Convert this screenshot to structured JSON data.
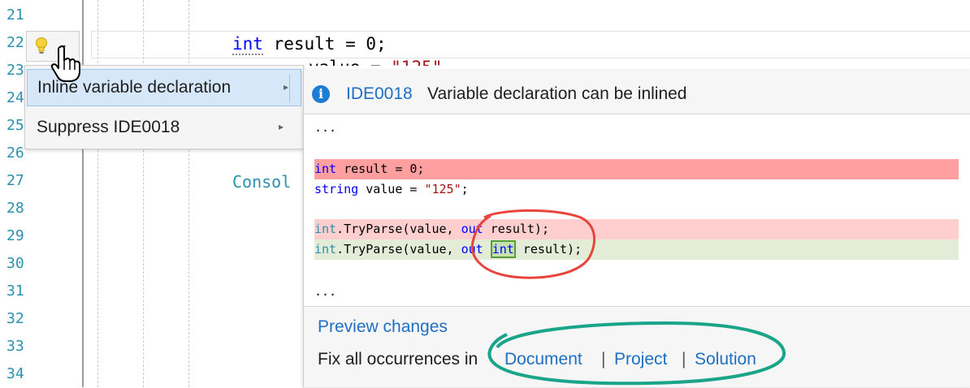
{
  "editor": {
    "line_numbers": [
      "21",
      "22",
      "23",
      "24",
      "25",
      "26",
      "27",
      "28",
      "29",
      "30",
      "31",
      "32",
      "33",
      "34"
    ],
    "line22": {
      "kw": "int",
      "rest": " result = 0;"
    },
    "line23_partial": {
      "text": "value = ",
      "str": "\"125\""
    },
    "line27_partial": "Consol"
  },
  "lightbulb": {
    "icon": "lightbulb-icon"
  },
  "menu": {
    "items": [
      {
        "label": "Inline variable declaration",
        "arrow": "▸"
      },
      {
        "label": "Suppress IDE0018",
        "arrow": "▸"
      }
    ]
  },
  "preview": {
    "diagnostic_id": "IDE0018",
    "message": "Variable declaration can be inlined",
    "ellipsis_top": "...",
    "ellipsis_bottom": "...",
    "code": {
      "del1_kw": "int",
      "del1_rest": " result = 0;",
      "ctx_kw": "string",
      "ctx_mid": " value = ",
      "ctx_str": "\"125\"",
      "ctx_end": ";",
      "tp_type": "int",
      "tp_rest1": ".TryParse(value, ",
      "tp_out": "out",
      "del2_tail": " result);",
      "add_int": "int",
      "add_tail": " result);"
    },
    "preview_changes": "Preview changes",
    "fix_all_prefix": "Fix all occurrences in",
    "scope_document": "Document",
    "scope_project": "Project",
    "scope_solution": "Solution",
    "scope_sep": "|"
  },
  "colors": {
    "line_number": "#2b91af",
    "deleted_line": "#ff9f9f",
    "added_line": "#e3ecd6",
    "link": "#1e6fc4",
    "annotation_red": "#e8453c",
    "annotation_teal": "#1aa58a"
  }
}
